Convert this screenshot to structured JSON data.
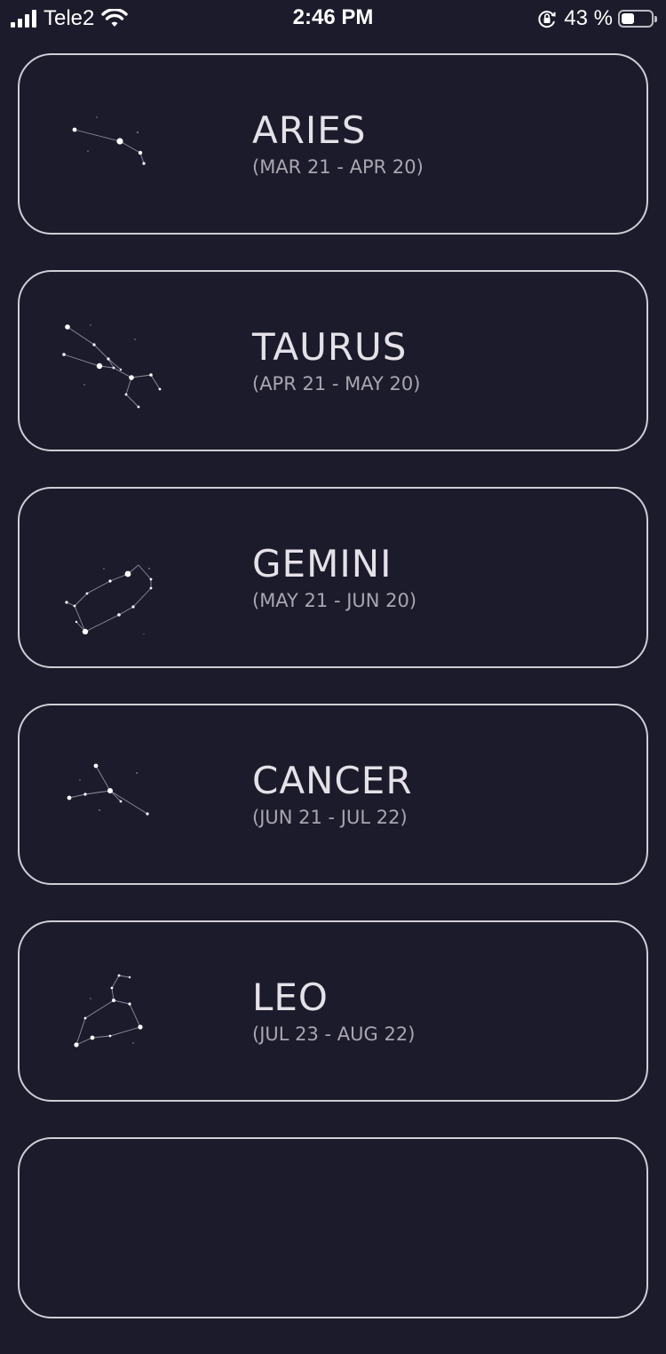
{
  "status_bar": {
    "carrier": "Tele2",
    "time": "2:46 PM",
    "battery_percent": "43 %",
    "battery_level": 0.43,
    "icons": [
      "signal-icon",
      "wifi-icon",
      "rotation-lock-icon",
      "battery-icon"
    ]
  },
  "signs": [
    {
      "name": "ARIES",
      "dates": "(MAR 21 - APR 20)"
    },
    {
      "name": "TAURUS",
      "dates": "(APR 21 - MAY 20)"
    },
    {
      "name": "GEMINI",
      "dates": "(MAY 21 - JUN 20)"
    },
    {
      "name": "CANCER",
      "dates": "(JUN 21 - JUL 22)"
    },
    {
      "name": "LEO",
      "dates": "(JUL 23 - AUG 22)"
    },
    {
      "name": "",
      "dates": ""
    }
  ],
  "colors": {
    "background": "#1c1b2b",
    "card_border": "#cfcdd6",
    "title": "#e4e1e8",
    "subtitle": "#a9a6b1"
  }
}
